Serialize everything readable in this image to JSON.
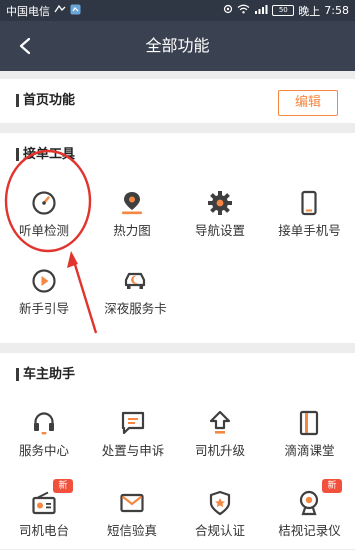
{
  "status_bar": {
    "carrier": "中国电信",
    "time_prefix": "晚上",
    "time": "7:58",
    "battery": "50"
  },
  "header": {
    "title": "全部功能",
    "back_icon": "back-arrow-icon"
  },
  "home_section": {
    "title": "首页功能",
    "edit_label": "编辑"
  },
  "order_tools": {
    "title": "接单工具",
    "items": [
      {
        "label": "听单检测",
        "icon": "gauge-icon"
      },
      {
        "label": "热力图",
        "icon": "map-pin-icon"
      },
      {
        "label": "导航设置",
        "icon": "gear-icon"
      },
      {
        "label": "接单手机号",
        "icon": "phone-icon"
      },
      {
        "label": "新手引导",
        "icon": "play-icon"
      },
      {
        "label": "深夜服务卡",
        "icon": "night-car-icon"
      }
    ]
  },
  "owner_helper": {
    "title": "车主助手",
    "items": [
      {
        "label": "服务中心",
        "icon": "headset-icon"
      },
      {
        "label": "处置与申诉",
        "icon": "message-icon"
      },
      {
        "label": "司机升级",
        "icon": "upgrade-icon"
      },
      {
        "label": "滴滴课堂",
        "icon": "book-icon"
      },
      {
        "label": "司机电台",
        "icon": "radio-icon",
        "badge": "新"
      },
      {
        "label": "短信验真",
        "icon": "mail-icon"
      },
      {
        "label": "合规认证",
        "icon": "certify-icon"
      },
      {
        "label": "桔视记录仪",
        "icon": "camera-icon",
        "badge": "新"
      }
    ]
  },
  "colors": {
    "accent": "#f58742",
    "nav_bg": "#3a4150",
    "status_bg": "#303744",
    "annotation_red": "#e0342c"
  }
}
